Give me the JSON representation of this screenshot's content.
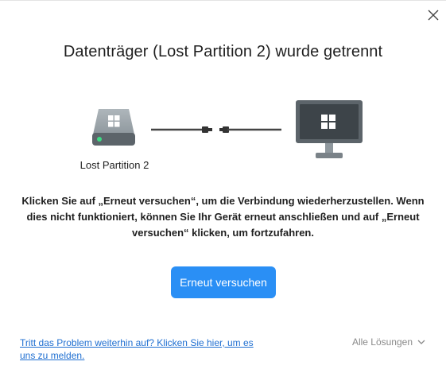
{
  "dialog": {
    "title": "Datenträger (Lost Partition 2) wurde getrennt",
    "close_icon": "close-icon"
  },
  "illustration": {
    "drive_icon": "drive-icon",
    "drive_label": "Lost Partition 2",
    "cable_icon": "cable-icon",
    "monitor_icon": "monitor-icon",
    "accent_color": "#2a8ff5"
  },
  "message": "Klicken Sie auf „Erneut versuchen“, um die Verbindung wiederherzustellen. Wenn dies nicht funktioniert, können Sie Ihr Gerät erneut anschließen und auf „Erneut versuchen“ klicken, um fortzufahren.",
  "actions": {
    "retry_label": "Erneut versuchen"
  },
  "footer": {
    "report_link": "Tritt das Problem weiterhin auf? Klicken Sie hier, um es uns zu melden.",
    "solutions_label": "Alle Lösungen",
    "solutions_icon": "chevron-down-icon"
  }
}
